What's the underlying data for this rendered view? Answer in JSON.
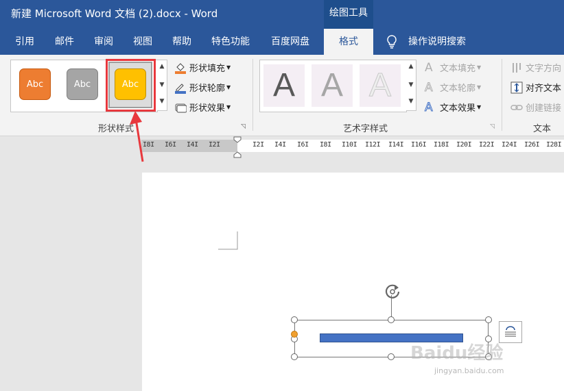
{
  "window": {
    "title": "新建 Microsoft Word 文档 (2).docx  -  Word",
    "context_tab": "绘图工具"
  },
  "tabs": [
    {
      "label": "引用",
      "active": false
    },
    {
      "label": "邮件",
      "active": false
    },
    {
      "label": "审阅",
      "active": false
    },
    {
      "label": "视图",
      "active": false
    },
    {
      "label": "帮助",
      "active": false
    },
    {
      "label": "特色功能",
      "active": false
    },
    {
      "label": "百度网盘",
      "active": false
    },
    {
      "label": "格式",
      "active": true
    }
  ],
  "tell_me": {
    "label": "操作说明搜索"
  },
  "shape_styles": {
    "group_label": "形状样式",
    "swatches": [
      {
        "label": "Abc",
        "color": "#ed7d31"
      },
      {
        "label": "Abc",
        "color": "#a5a5a5"
      },
      {
        "label": "Abc",
        "color": "#ffc000",
        "selected": true
      }
    ],
    "fill_label": "形状填充",
    "outline_label": "形状轮廓",
    "effect_label": "形状效果"
  },
  "wordart": {
    "group_label": "艺术字样式",
    "samples": [
      "A",
      "A",
      "A"
    ],
    "text_fill_label": "文本填充",
    "text_outline_label": "文本轮廓",
    "text_effect_label": "文本效果"
  },
  "text_group": {
    "group_label": "文本",
    "direction_label": "文字方向",
    "align_label": "对齐文本",
    "link_label": "创建链接"
  },
  "ruler": {
    "left_ticks": [
      "8",
      "6",
      "4",
      "2"
    ],
    "right_ticks": [
      "2",
      "4",
      "6",
      "8",
      "10",
      "12",
      "14",
      "16",
      "18",
      "20",
      "22",
      "24",
      "26",
      "28"
    ]
  },
  "colors": {
    "accent": "#2b579a",
    "highlight": "#e8383d",
    "selected_bar": "#4472c4"
  },
  "watermark": {
    "brand": "Baidu经验",
    "url": "jingyan.baidu.com"
  }
}
